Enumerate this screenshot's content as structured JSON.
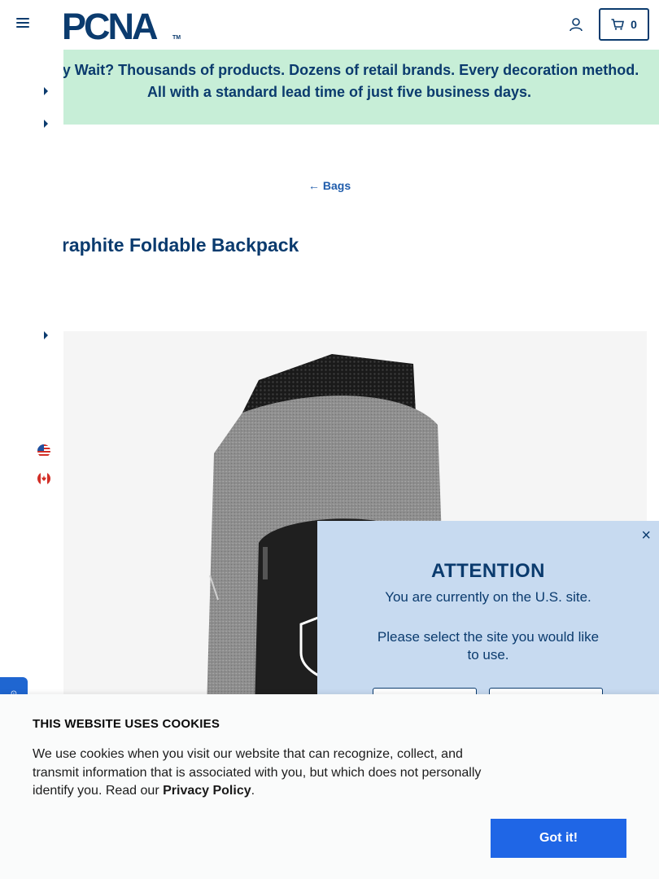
{
  "header": {
    "menu_icon": "hamburger-icon",
    "logo_text": "PCNA",
    "logo_tm": "TM",
    "account_icon": "user-icon",
    "cart_icon": "cart-icon",
    "cart_count": "0"
  },
  "banner": {
    "text": "Why Wait? Thousands of products. Dozens of retail brands. Every decoration method. All with a standard lead time of just five business days."
  },
  "side_nav": {
    "caret_icon": "caret-right-icon",
    "flags": [
      "us-flag-icon",
      "canada-flag-icon"
    ]
  },
  "breadcrumb": {
    "arrow": "←",
    "label": "Bags"
  },
  "product": {
    "title": "Graphite Foldable Backpack"
  },
  "feedback_tab": {
    "label": "⊙"
  },
  "modal": {
    "close": "×",
    "heading": "ATTENTION",
    "line1": "You are currently on the U.S. site.",
    "line2": "Please select the site you would like to use."
  },
  "cookie": {
    "title": "THIS WEBSITE USES COOKIES",
    "text_before": "We use cookies when you visit our website that can recognize, collect, and transmit information that is associated with you, but which does not personally identify you. Read our ",
    "link": "Privacy Policy",
    "text_after": ".",
    "button": "Got it!"
  },
  "colors": {
    "brand_navy": "#0b3b6e",
    "banner_green": "#c7eed7",
    "modal_blue": "#c7daf0",
    "button_blue": "#1f66e6"
  }
}
